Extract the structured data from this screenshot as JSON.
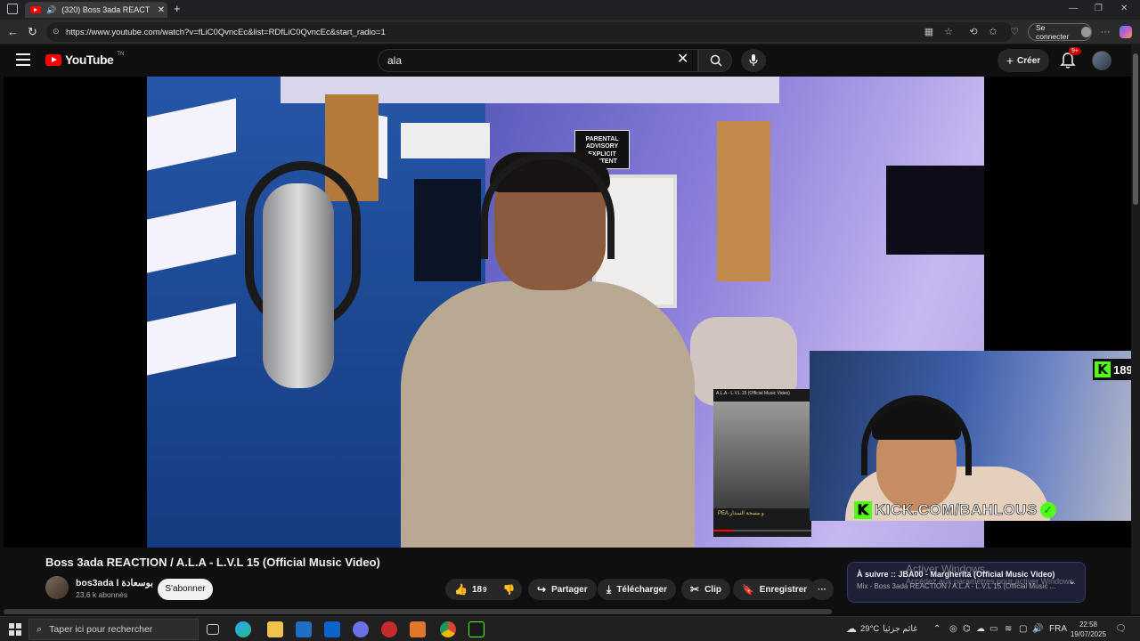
{
  "browser": {
    "tab_title": "(320) Boss 3ada REACTION /",
    "url": "https://www.youtube.com/watch?v=fLiC0QvncEc&list=RDfLiC0QvncEc&start_radio=1",
    "signin_label": "Se connecter"
  },
  "youtube": {
    "logo_text": "YouTube",
    "logo_region": "TN",
    "search_value": "ala",
    "create_label": "Créer",
    "notif_badge": "9+"
  },
  "video": {
    "advisory_text": "PARENTAL ADVISORY EXPLICIT CONTENT",
    "pip_title": "A.L.A - L.V.L 15 (Official Music Video)",
    "pip_subtitle": "PEA و مسحة السدار",
    "kick_count": "189",
    "kick_url": "KICK.COM/BAHLOUS",
    "title": "Boss 3ada REACTION / A.L.A - L.V.L 15 (Official Music Video)"
  },
  "channel": {
    "name": "bos3ada l بوسعادة",
    "subscribers": "23,6 k abonnés",
    "subscribe_label": "S'abonner"
  },
  "actions": {
    "like_count": "18",
    "like_count_sub": "9",
    "share_label": "Partager",
    "download_label": "Télécharger",
    "clip_label": "Clip",
    "save_label": "Enregistrer"
  },
  "up_next": {
    "title": "À suivre :: JBA00 - Margherita (Official Music Video)",
    "subtitle": "Mix - Boss 3ada REACTION / A.L.A - L.V.L 15 (Official Music ..."
  },
  "windows_activation": {
    "title": "Activer Windows",
    "subtitle": "Accédez aux paramètres pour activer Windows."
  },
  "taskbar": {
    "search_placeholder": "Taper ici pour rechercher",
    "temperature": "29°C",
    "weather_text": "غائم جزئيا",
    "language": "FRA",
    "time": "22:58",
    "date": "19/07/2025"
  },
  "colors": {
    "yt_red": "#ff0000",
    "kick_green": "#53fc18",
    "background": "#0f0f0f"
  }
}
